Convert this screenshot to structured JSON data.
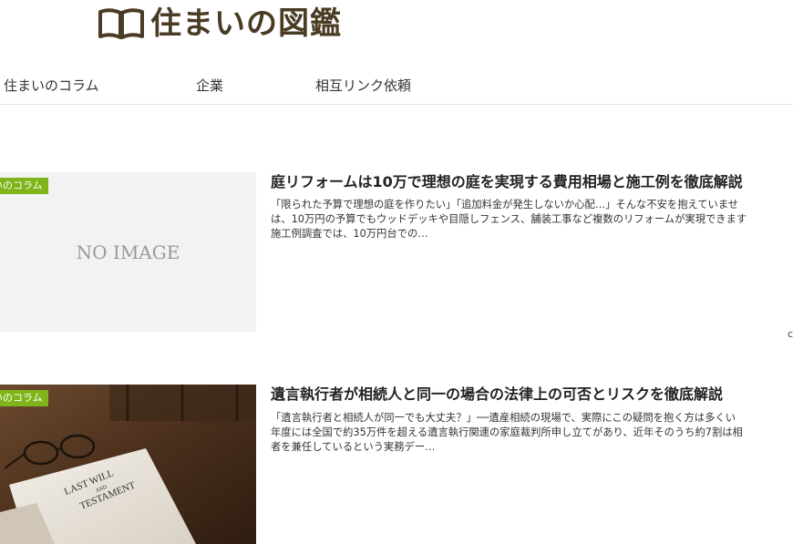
{
  "site": {
    "logo_text": "住まいの図鑑"
  },
  "nav": {
    "items": [
      {
        "label": "住まいのコラム"
      },
      {
        "label": "企業"
      },
      {
        "label": "相互リンク依頼"
      }
    ]
  },
  "articles": [
    {
      "category": "いのコラム",
      "thumbnail_text": "NO IMAGE",
      "title": "庭リフォームは10万で理想の庭を実現する費用相場と施工例を徹底解説",
      "excerpt_lines": [
        "「限られた予算で理想の庭を作りたい」「追加料金が発生しないか心配…」そんな不安を抱えていませ",
        "は、10万円の予算でもウッドデッキや目隠しフェンス、舗装工事など複数のリフォームが実現できます",
        "施工例調査では、10万円台での…"
      ]
    },
    {
      "category": "いのコラム",
      "thumbnail_text_1": "LAST WILL",
      "thumbnail_text_2": "AND",
      "thumbnail_text_3": "TESTAMENT",
      "title": "遺言執行者が相続人と同一の場合の法律上の可否とリスクを徹底解説",
      "excerpt_lines": [
        "「遺言執行者と相続人が同一でも大丈夫？」──遺産相続の現場で、実際にこの疑問を抱く方は多くい",
        "年度には全国で約35万件を超える遺言執行関連の家庭裁判所申し立てがあり、近年そのうち約7割は相",
        "者を兼任しているという実務デー…"
      ]
    }
  ],
  "misc": {
    "edge_mark": "c"
  }
}
